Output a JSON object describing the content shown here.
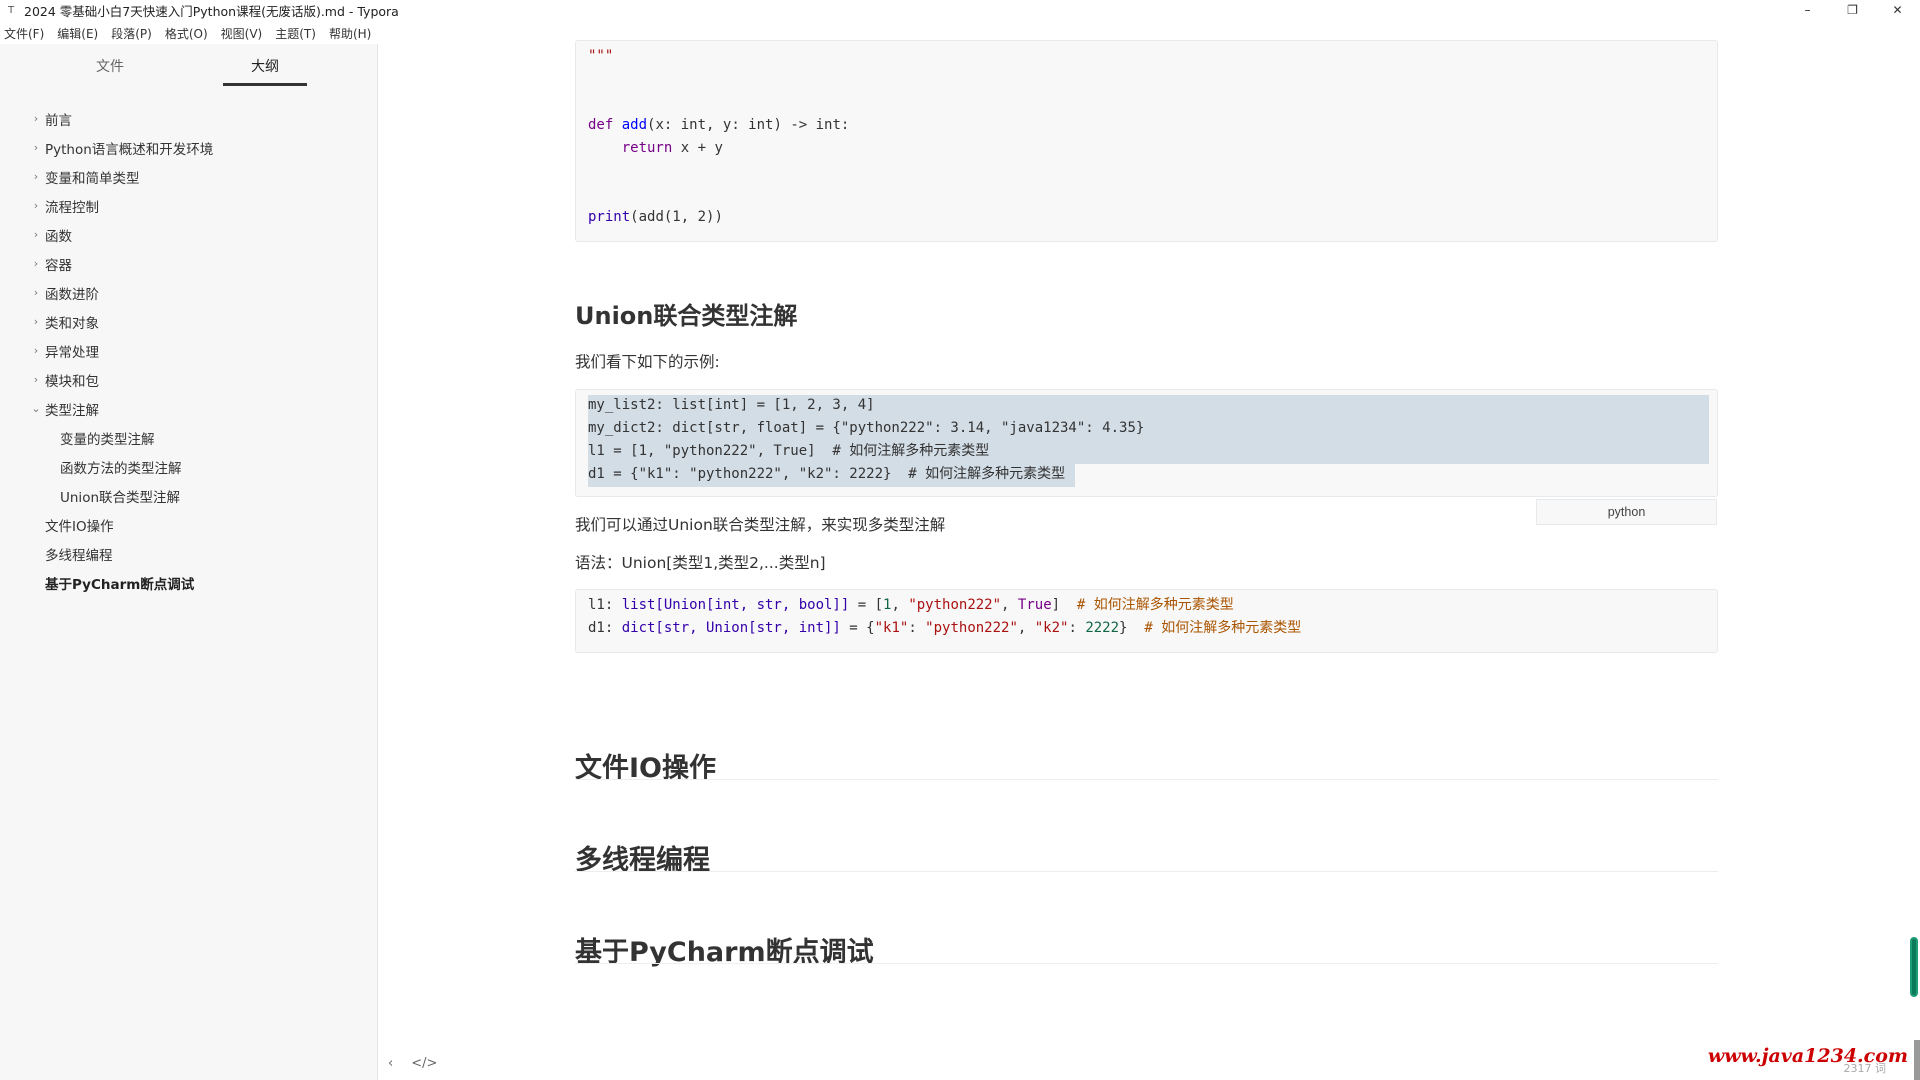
{
  "window": {
    "title": "2024 零基础小白7天快速入门Python课程(无废话版).md - Typora",
    "icon": "typora-icon",
    "minimize": "–",
    "restore": "❐",
    "close": "✕"
  },
  "menu": [
    "文件(F)",
    "编辑(E)",
    "段落(P)",
    "格式(O)",
    "视图(V)",
    "主题(T)",
    "帮助(H)"
  ],
  "sidebar": {
    "tabs": {
      "files": "文件",
      "outline": "大纲"
    },
    "items": [
      {
        "label": "前言",
        "level": 1,
        "chevron": "›"
      },
      {
        "label": "Python语言概述和开发环境",
        "level": 1,
        "chevron": "›"
      },
      {
        "label": "变量和简单类型",
        "level": 1,
        "chevron": "›"
      },
      {
        "label": "流程控制",
        "level": 1,
        "chevron": "›"
      },
      {
        "label": "函数",
        "level": 1,
        "chevron": "›"
      },
      {
        "label": "容器",
        "level": 1,
        "chevron": "›"
      },
      {
        "label": "函数进阶",
        "level": 1,
        "chevron": "›"
      },
      {
        "label": "类和对象",
        "level": 1,
        "chevron": "›"
      },
      {
        "label": "异常处理",
        "level": 1,
        "chevron": "›"
      },
      {
        "label": "模块和包",
        "level": 1,
        "chevron": "›"
      },
      {
        "label": "类型注解",
        "level": 1,
        "chevron": "⌄"
      },
      {
        "label": "变量的类型注解",
        "level": 2
      },
      {
        "label": "函数方法的类型注解",
        "level": 2
      },
      {
        "label": "Union联合类型注解",
        "level": 2
      },
      {
        "label": "文件IO操作",
        "level": 1
      },
      {
        "label": "多线程编程",
        "level": 1
      },
      {
        "label": "基于PyCharm断点调试",
        "level": 1,
        "active": true
      }
    ]
  },
  "content": {
    "code1": {
      "line0": "\"\"\"",
      "def_kw": "def",
      "fn_name": "add",
      "params": "(x: int, y: int) -> int:",
      "return_kw": "return",
      "return_expr": " x + y",
      "print_call": "print",
      "print_args": "(add(1, 2))"
    },
    "h_union": "Union联合类型注解",
    "p_example": "我们看下如下的示例:",
    "code2": [
      "my_list2: list[int] = [1, 2, 3, 4]",
      "my_dict2: dict[str, float] = {\"python222\": 3.14, \"java1234\": 4.35}",
      "l1 = [1, \"python222\", True]  # 如何注解多种元素类型",
      "d1 = {\"k1\": \"python222\", \"k2\": 2222}  # 如何注解多种元素类型"
    ],
    "lang_tag": "python",
    "p_union": "我们可以通过Union联合类型注解，来实现多类型注解",
    "p_syntax": "语法：Union[类型1,类型2,...类型n]",
    "code3": {
      "l1_var": "l1",
      "l1_type": "list[Union[int, str, bool]]",
      "l1_val_open": "[",
      "l1_num": "1",
      "l1_str": "\"python222\"",
      "l1_true": "True",
      "l1_comment": "# 如何注解多种元素类型",
      "d1_var": "d1",
      "d1_type": "dict[str, Union[str, int]]",
      "d1_k1": "\"k1\"",
      "d1_v1": "\"python222\"",
      "d1_k2": "\"k2\"",
      "d1_v2": "2222",
      "d1_comment": "# 如何注解多种元素类型"
    },
    "h_fileio": "文件IO操作",
    "h_thread": "多线程编程",
    "h_pycharm": "基于PyCharm断点调试"
  },
  "footer": {
    "back": "‹",
    "source": "</>",
    "watermark": "www.java1234.com",
    "wordcount": "2317 词"
  }
}
